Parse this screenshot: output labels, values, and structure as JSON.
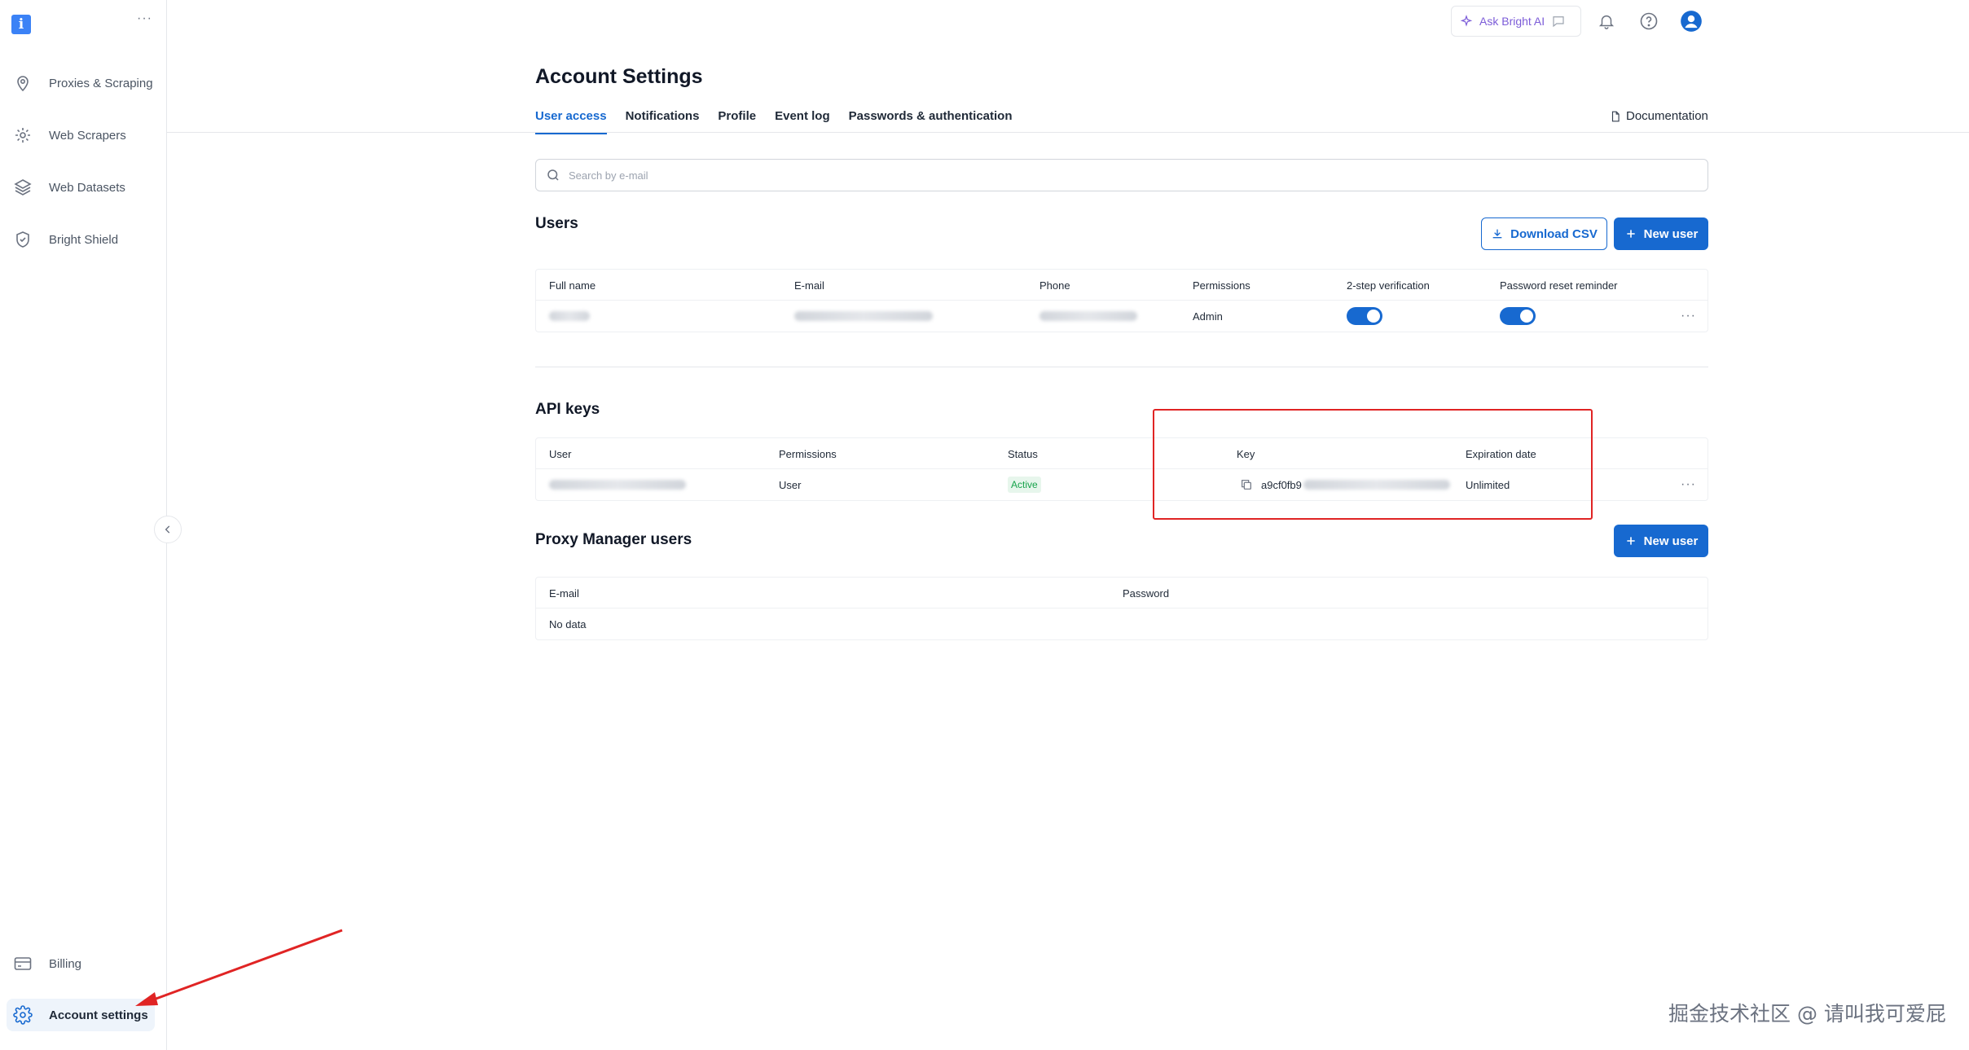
{
  "sidebar": {
    "logo_letter": "i",
    "more": "···",
    "items": [
      {
        "label": "Proxies & Scraping",
        "icon": "location-pin-icon"
      },
      {
        "label": "Web Scrapers",
        "icon": "gear-icon"
      },
      {
        "label": "Web Datasets",
        "icon": "layers-icon"
      },
      {
        "label": "Bright Shield",
        "icon": "shield-icon"
      }
    ],
    "bottom_items": [
      {
        "label": "Billing",
        "icon": "credit-card-icon"
      },
      {
        "label": "Account settings",
        "icon": "settings-icon",
        "active": true
      }
    ]
  },
  "topbar": {
    "ask_label": "Ask Bright AI"
  },
  "page": {
    "title": "Account Settings",
    "tabs": [
      {
        "label": "User access",
        "active": true
      },
      {
        "label": "Notifications"
      },
      {
        "label": "Profile"
      },
      {
        "label": "Event log"
      },
      {
        "label": "Passwords & authentication"
      }
    ],
    "documentation_label": "Documentation",
    "search_placeholder": "Search by e-mail"
  },
  "users": {
    "title": "Users",
    "download_label": "Download CSV",
    "new_user_label": "New user",
    "columns": [
      "Full name",
      "E-mail",
      "Phone",
      "Permissions",
      "2-step verification",
      "Password reset reminder"
    ],
    "rows": [
      {
        "permissions": "Admin",
        "two_step": true,
        "reset_reminder": true
      }
    ]
  },
  "api_keys": {
    "title": "API keys",
    "columns": [
      "User",
      "Permissions",
      "Status",
      "Key",
      "Expiration date"
    ],
    "rows": [
      {
        "permissions": "User",
        "status": "Active",
        "key_prefix": "a9cf0fb9",
        "expiration": "Unlimited"
      }
    ]
  },
  "proxy_manager": {
    "title": "Proxy Manager users",
    "new_user_label": "New user",
    "columns": [
      "E-mail",
      "Password"
    ],
    "empty": "No data"
  },
  "colors": {
    "accent": "#1769d0",
    "annotation": "#e02424",
    "status_active": "#16a34a"
  },
  "watermark": "掘金技术社区 @ 请叫我可爱屁"
}
